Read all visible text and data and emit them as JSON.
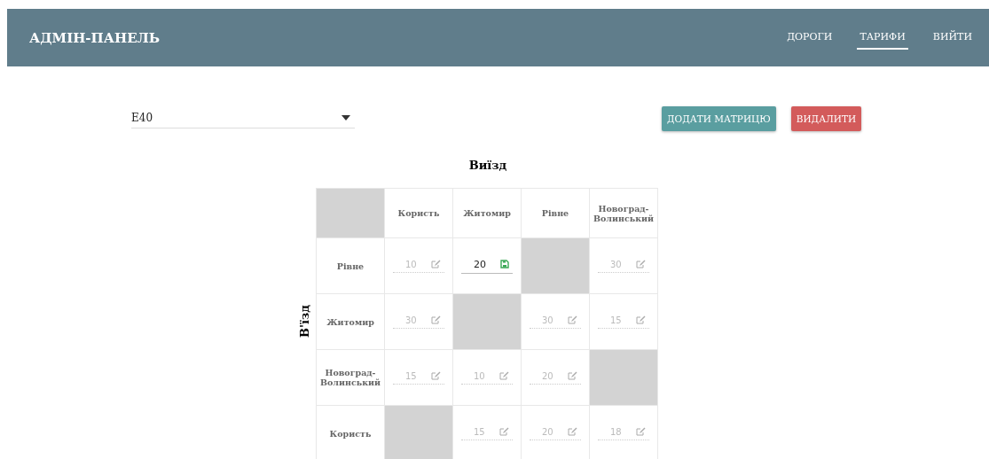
{
  "header": {
    "title": "АДМІН-ПАНЕЛЬ",
    "nav": [
      {
        "label": "ДОРОГИ",
        "selected": false
      },
      {
        "label": "ТАРИФИ",
        "selected": true
      },
      {
        "label": "ВИЙТИ",
        "selected": false
      }
    ]
  },
  "road_select": {
    "value": "E40"
  },
  "buttons": [
    {
      "label": "ДОДАТИ МАТРИЦЮ",
      "kind": "primary"
    },
    {
      "label": "ВИДАЛИТИ",
      "kind": "danger"
    }
  ],
  "matrix": {
    "exit_label": "Виїзд",
    "entry_label": "В'їзд",
    "columns": [
      "Користь",
      "Житомир",
      "Рівне",
      "Новоград-Волинський"
    ],
    "rows": [
      {
        "label": "Рівне",
        "cells": [
          {
            "kind": "value",
            "value": "10",
            "editing": false
          },
          {
            "kind": "value",
            "value": "20",
            "editing": true
          },
          {
            "kind": "blank"
          },
          {
            "kind": "value",
            "value": "30",
            "editing": false
          }
        ]
      },
      {
        "label": "Житомир",
        "cells": [
          {
            "kind": "value",
            "value": "30",
            "editing": false
          },
          {
            "kind": "blank"
          },
          {
            "kind": "value",
            "value": "30",
            "editing": false
          },
          {
            "kind": "value",
            "value": "15",
            "editing": false
          }
        ]
      },
      {
        "label": "Новоград-Волинський",
        "cells": [
          {
            "kind": "value",
            "value": "15",
            "editing": false
          },
          {
            "kind": "value",
            "value": "10",
            "editing": false
          },
          {
            "kind": "value",
            "value": "20",
            "editing": false
          },
          {
            "kind": "blank"
          }
        ]
      },
      {
        "label": "Користь",
        "cells": [
          {
            "kind": "blank"
          },
          {
            "kind": "value",
            "value": "15",
            "editing": false
          },
          {
            "kind": "value",
            "value": "20",
            "editing": false
          },
          {
            "kind": "value",
            "value": "18",
            "editing": false
          }
        ]
      }
    ]
  }
}
